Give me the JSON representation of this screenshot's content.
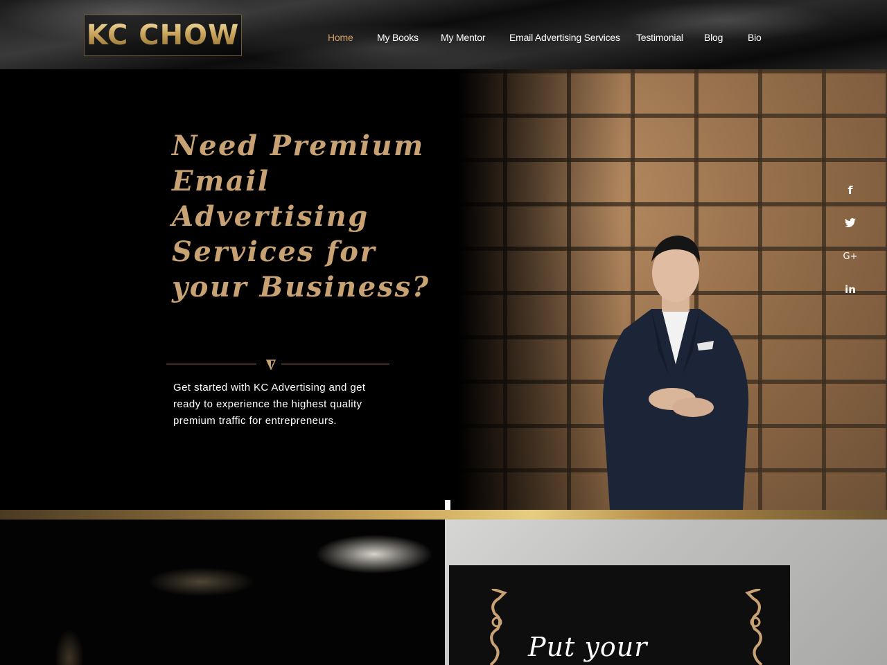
{
  "brand": {
    "logo_text": "KC CHOW"
  },
  "nav": {
    "items": [
      {
        "label": "Home",
        "active": true
      },
      {
        "label": "My Books",
        "active": false
      },
      {
        "label": "My Mentor",
        "active": false
      },
      {
        "label": "Email Advertising Services",
        "active": false
      },
      {
        "label": "Testimonial",
        "active": false
      },
      {
        "label": "Blog",
        "active": false
      },
      {
        "label": "Bio",
        "active": false
      }
    ]
  },
  "hero": {
    "headline": "Need Premium Email Advertising Services for your Business?",
    "intro": "Get started with KC Advertising and get ready to experience the highest quality premium traffic for entrepreneurs."
  },
  "social": {
    "items": [
      {
        "icon": "facebook-icon",
        "glyph": "f"
      },
      {
        "icon": "twitter-icon",
        "glyph": "t"
      },
      {
        "icon": "google-plus-icon",
        "glyph": "G+"
      },
      {
        "icon": "linkedin-icon",
        "glyph": "in"
      }
    ]
  },
  "promo": {
    "heading_partial": "Put your"
  },
  "colors": {
    "accent_gold": "#c9a274",
    "nav_active": "#d4a36b",
    "background": "#000000"
  }
}
